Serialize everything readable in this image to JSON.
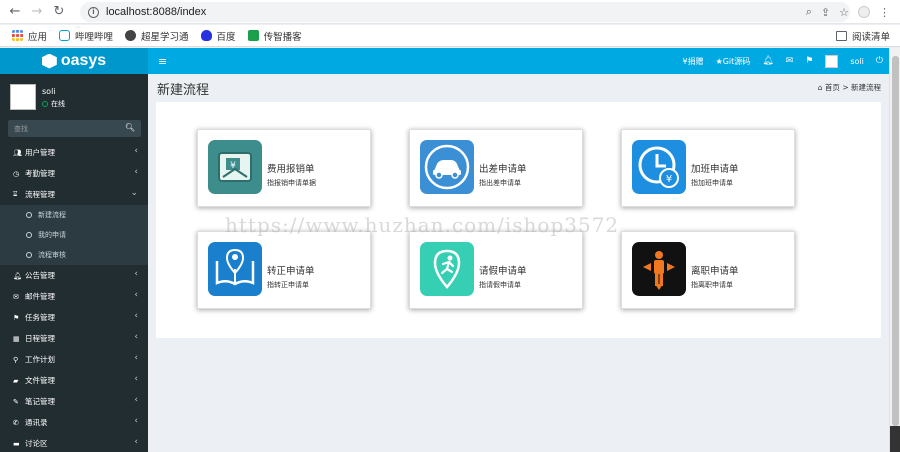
{
  "browser": {
    "url": "localhost:8088/index",
    "bookmarks": [
      {
        "label": "应用",
        "icon": "apps-grid-icon",
        "color": "#4285f4"
      },
      {
        "label": "哔哩哔哩",
        "icon": "bilibili-icon",
        "color": "#00a1d6"
      },
      {
        "label": "超星学习通",
        "icon": "globe-icon",
        "color": "#444444"
      },
      {
        "label": "百度",
        "icon": "baidu-paw-icon",
        "color": "#2932e1"
      },
      {
        "label": "传智播客",
        "icon": "itcast-icon",
        "color": "#1a9f4a"
      }
    ],
    "reading_list": "阅读清单"
  },
  "header": {
    "logo": "oasys",
    "menu_toggle": "≡",
    "items": [
      "¥捐赠",
      "★Git源码"
    ],
    "username": "soli"
  },
  "sidebar": {
    "user": {
      "name": "soli",
      "status": "在线"
    },
    "search_placeholder": "查找",
    "menu": [
      {
        "label": "用户管理",
        "icon": "users-icon"
      },
      {
        "label": "考勤管理",
        "icon": "clock-icon"
      },
      {
        "label": "流程管理",
        "icon": "hourglass-icon",
        "expanded": true,
        "children": [
          "新建流程",
          "我的申请",
          "流程审核"
        ]
      },
      {
        "label": "公告管理",
        "icon": "bell-icon"
      },
      {
        "label": "邮件管理",
        "icon": "envelope-icon"
      },
      {
        "label": "任务管理",
        "icon": "flag-icon"
      },
      {
        "label": "日程管理",
        "icon": "calendar-icon"
      },
      {
        "label": "工作计划",
        "icon": "plan-icon"
      },
      {
        "label": "文件管理",
        "icon": "folder-icon"
      },
      {
        "label": "笔记管理",
        "icon": "edit-icon"
      },
      {
        "label": "通讯录",
        "icon": "phone-icon"
      },
      {
        "label": "讨论区",
        "icon": "comment-icon"
      }
    ]
  },
  "content": {
    "title": "新建流程",
    "breadcrumb": {
      "home": "首页",
      "separator": ">",
      "current": "新建流程"
    },
    "cards": [
      {
        "title": "费用报销单",
        "subtitle": "指报销申请单据",
        "icon": "money-hand-icon",
        "color": "#3c8d8c"
      },
      {
        "title": "出差申请单",
        "subtitle": "指出差申请单",
        "icon": "car-icon",
        "color": "#3b8fd4"
      },
      {
        "title": "加班申请单",
        "subtitle": "指加班申请单",
        "icon": "clock-yen-icon",
        "color": "#1e8fe0"
      },
      {
        "title": "转正申请单",
        "subtitle": "指转正申请单",
        "icon": "book-person-icon",
        "color": "#1a7fcc"
      },
      {
        "title": "请假申请单",
        "subtitle": "指请假申请单",
        "icon": "running-person-icon",
        "color": "#36cfb4"
      },
      {
        "title": "离职申请单",
        "subtitle": "指离职申请单",
        "icon": "exit-person-icon",
        "color": "#111111"
      }
    ]
  },
  "watermark": "https://www.huzhan.com/ishop3572"
}
